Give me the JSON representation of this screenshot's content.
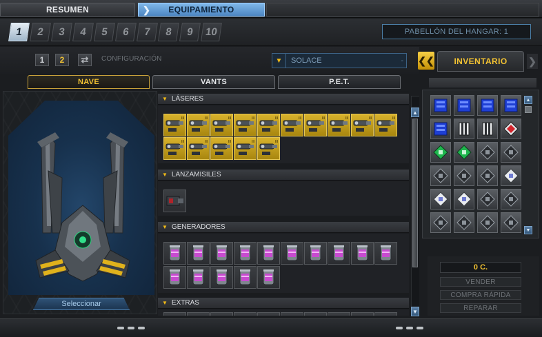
{
  "top_tabs": {
    "resumen": "RESUMEN",
    "equipamiento": "EQUIPAMIENTO"
  },
  "hangar": {
    "numbers": [
      "1",
      "2",
      "3",
      "4",
      "5",
      "6",
      "7",
      "8",
      "9",
      "10"
    ],
    "active": "1",
    "label": "PABELLÓN DEL HANGAR: 1"
  },
  "config": {
    "buttons": [
      "1",
      "2"
    ],
    "active": "2",
    "label": "CONFIGURACIÓN",
    "ship_name": "SOLACE"
  },
  "inventory": {
    "title": "INVENTARIO",
    "credits": "0 C.",
    "actions": {
      "sell": "VENDER",
      "quick_buy": "COMPRA RÁPIDA",
      "repair": "REPARAR"
    },
    "items": [
      "blue-chip",
      "blue-chip",
      "blue-chip",
      "blue-chip",
      "blue-chip",
      "gray-box",
      "gray-box",
      "red-module",
      "green-module",
      "green-module",
      "gray-module",
      "gray-module",
      "gray-module",
      "gray-module",
      "gray-module",
      "white-module",
      "white-module",
      "white-module",
      "gray-module",
      "gray-module",
      "gray-module",
      "gray-module",
      "gray-module",
      "gray-module"
    ]
  },
  "subtabs": {
    "nave": "NAVE",
    "vants": "VANTS",
    "pet": "P.E.T."
  },
  "ship": {
    "select_label": "Seleccionar"
  },
  "sections": {
    "lasers": {
      "title": "LÁSERES",
      "count": 15
    },
    "rockets": {
      "title": "LANZAMISILES",
      "count": 1
    },
    "generators": {
      "title": "GENERADORES",
      "count": 15
    },
    "extras": {
      "title": "EXTRAS"
    }
  },
  "colors": {
    "accent_gold": "#f2c232",
    "accent_blue": "#4d86c2",
    "laser_slot": "#d8b22c"
  }
}
